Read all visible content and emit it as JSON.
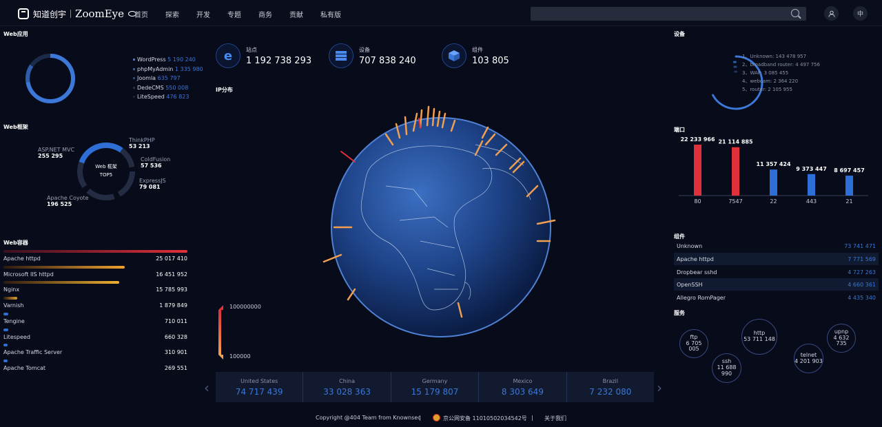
{
  "header": {
    "logo_cn": "知道创宇",
    "logo_en": "ZoomEye",
    "nav": [
      "首页",
      "探索",
      "开发",
      "专题",
      "商务",
      "贡献",
      "私有版"
    ],
    "search_placeholder": "",
    "lang": "中"
  },
  "web_apps": {
    "title": "Web应用",
    "items": [
      {
        "name": "WordPress",
        "value": "5 190 240",
        "color": "#3b78d8"
      },
      {
        "name": "phpMyAdmin",
        "value": "1 335 980",
        "color": "#2f5ea8"
      },
      {
        "name": "Joomla",
        "value": "635 797",
        "color": "#26487e"
      },
      {
        "name": "DedeCMS",
        "value": "550 008",
        "color": "#1d3459"
      },
      {
        "name": "LiteSpeed",
        "value": "476 823",
        "color": "#182640"
      }
    ]
  },
  "web_framework": {
    "title": "Web框架",
    "center_label": "Web 框架",
    "center_sub": "TOP5",
    "items": [
      {
        "name": "ThinkPHP",
        "value": "53 213"
      },
      {
        "name": "ASP.NET MVC",
        "value": "255 295"
      },
      {
        "name": "ColdFusion",
        "value": "57 536"
      },
      {
        "name": "ExpressJS",
        "value": "79 081"
      },
      {
        "name": "Apache Coyote",
        "value": "196 525"
      }
    ]
  },
  "web_containers": {
    "title": "Web容器",
    "items": [
      {
        "name": "Apache httpd",
        "value": "25 017 410",
        "fill": 1.0
      },
      {
        "name": "Microsoft IIS httpd",
        "value": "16 451 952",
        "fill": 0.66
      },
      {
        "name": "Nginx",
        "value": "15 785 993",
        "fill": 0.63
      },
      {
        "name": "Varnish",
        "value": "1 879 849",
        "fill": 0.075
      },
      {
        "name": "Tengine",
        "value": "710 011",
        "fill": 0.028
      },
      {
        "name": "Litespeed",
        "value": "660 328",
        "fill": 0.026
      },
      {
        "name": "Apache Traffic Server",
        "value": "310 901",
        "fill": 0.012
      },
      {
        "name": "Apache Tomcat",
        "value": "269 551",
        "fill": 0.011
      }
    ]
  },
  "stats": [
    {
      "label": "站点",
      "value": "1 192 738 293",
      "icon": "ie-icon"
    },
    {
      "label": "设备",
      "value": "707 838 240",
      "icon": "server-icon"
    },
    {
      "label": "组件",
      "value": "103 805",
      "icon": "cube-icon"
    }
  ],
  "ip_dist": {
    "title": "IP分布",
    "scale_max": "100000000",
    "scale_min": "100000"
  },
  "countries": [
    {
      "name": "United States",
      "value": "74 717 439"
    },
    {
      "name": "China",
      "value": "33 028 363"
    },
    {
      "name": "Germany",
      "value": "15 179 807"
    },
    {
      "name": "Mexico",
      "value": "8 303 649"
    },
    {
      "name": "Brazil",
      "value": "7 232 080"
    }
  ],
  "devices": {
    "title": "设备",
    "items": [
      "1、Unknown: 143 478 957",
      "2、broadband router: 4 497 756",
      "3、WAP: 3 085 455",
      "4、webcam: 2 364 220",
      "5、router: 2 105 955"
    ]
  },
  "ports": {
    "title": "端口",
    "chart_data": {
      "type": "bar",
      "categories": [
        "80",
        "7547",
        "22",
        "443",
        "21"
      ],
      "values": [
        22233966,
        21114885,
        11357424,
        9373447,
        8697457
      ],
      "labels": [
        "22 233 966",
        "21 114 885",
        "11 357 424",
        "9 373 447",
        "8 697 457"
      ],
      "colors": [
        "#e0303a",
        "#e0303a",
        "#2d6fd6",
        "#2d6fd6",
        "#2d6fd6"
      ]
    }
  },
  "components": {
    "title": "组件",
    "items": [
      {
        "name": "Unknown",
        "value": "73 741 471"
      },
      {
        "name": "Apache httpd",
        "value": "7 771 569"
      },
      {
        "name": "Dropbear sshd",
        "value": "4 727 263"
      },
      {
        "name": "OpenSSH",
        "value": "4 660 361"
      },
      {
        "name": "Allegro RomPager",
        "value": "4 435 340"
      }
    ]
  },
  "services": {
    "title": "服务",
    "items": [
      {
        "name": "ftp",
        "value": "6 705 005"
      },
      {
        "name": "http",
        "value": "53 711 148"
      },
      {
        "name": "ssh",
        "value": "11 688 990"
      },
      {
        "name": "telnet",
        "value": "4 201 903"
      },
      {
        "name": "upnp",
        "value": "4 632 735"
      }
    ]
  },
  "footer": {
    "copyright": "Copyright @404 Team from Knownsec",
    "beian": "京公网安备 11010502034542号",
    "about": "关于我们",
    "sep": "|"
  }
}
